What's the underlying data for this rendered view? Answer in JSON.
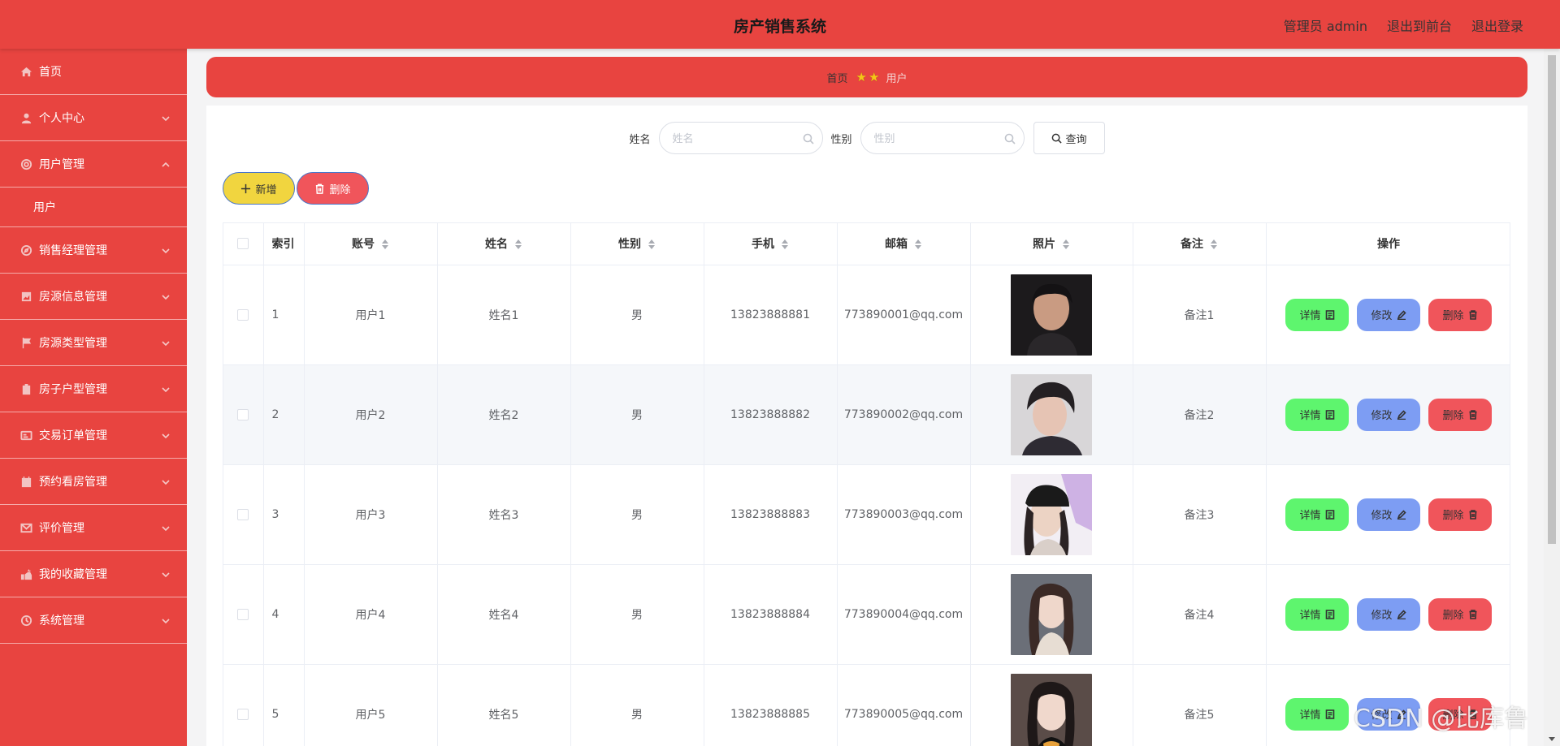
{
  "header": {
    "title": "房产销售系统",
    "admin_label": "管理员 admin",
    "front_link": "退出到前台",
    "logout_link": "退出登录"
  },
  "sidebar": {
    "items": [
      {
        "label": "首页",
        "icon": "home-icon",
        "has_chevron": false
      },
      {
        "label": "个人中心",
        "icon": "user-icon",
        "has_chevron": true
      },
      {
        "label": "用户管理",
        "icon": "users-gear-icon",
        "has_chevron": true,
        "expanded": true,
        "children": [
          {
            "label": "用户"
          }
        ]
      },
      {
        "label": "销售经理管理",
        "icon": "compass-icon",
        "has_chevron": true
      },
      {
        "label": "房源信息管理",
        "icon": "chart-icon",
        "has_chevron": true
      },
      {
        "label": "房源类型管理",
        "icon": "flag-icon",
        "has_chevron": true
      },
      {
        "label": "房子户型管理",
        "icon": "clipboard-icon",
        "has_chevron": true
      },
      {
        "label": "交易订单管理",
        "icon": "card-icon",
        "has_chevron": true
      },
      {
        "label": "预约看房管理",
        "icon": "calendar-icon",
        "has_chevron": true
      },
      {
        "label": "评价管理",
        "icon": "mail-icon",
        "has_chevron": true
      },
      {
        "label": "我的收藏管理",
        "icon": "star-hand-icon",
        "has_chevron": true
      },
      {
        "label": "系统管理",
        "icon": "settings-icon",
        "has_chevron": true
      }
    ]
  },
  "breadcrumb": {
    "home": "首页",
    "separator": "★★",
    "current": "用户"
  },
  "search": {
    "name_label": "姓名",
    "name_placeholder": "姓名",
    "name_value": "",
    "gender_label": "性别",
    "gender_placeholder": "性别",
    "gender_value": "",
    "query_button": "查询"
  },
  "actions": {
    "add_label": "新增",
    "delete_label": "删除"
  },
  "table": {
    "columns": [
      "索引",
      "账号",
      "姓名",
      "性别",
      "手机",
      "邮箱",
      "照片",
      "备注",
      "操作"
    ],
    "rows": [
      {
        "index": "1",
        "account": "用户1",
        "name": "姓名1",
        "gender": "男",
        "phone": "13823888881",
        "email": "773890001@qq.com",
        "remark": "备注1"
      },
      {
        "index": "2",
        "account": "用户2",
        "name": "姓名2",
        "gender": "男",
        "phone": "13823888882",
        "email": "773890002@qq.com",
        "remark": "备注2"
      },
      {
        "index": "3",
        "account": "用户3",
        "name": "姓名3",
        "gender": "男",
        "phone": "13823888883",
        "email": "773890003@qq.com",
        "remark": "备注3"
      },
      {
        "index": "4",
        "account": "用户4",
        "name": "姓名4",
        "gender": "男",
        "phone": "13823888884",
        "email": "773890004@qq.com",
        "remark": "备注4"
      },
      {
        "index": "5",
        "account": "用户5",
        "name": "姓名5",
        "gender": "男",
        "phone": "13823888885",
        "email": "773890005@qq.com",
        "remark": "备注5"
      }
    ],
    "op_detail": "详情",
    "op_edit": "修改",
    "op_delete": "删除"
  },
  "watermark": "CSDN @比库鲁",
  "colors": {
    "primary": "#e84440",
    "add_button": "#f1d53f",
    "delete_button": "#f0555b",
    "detail_button": "#5ef56e",
    "edit_button": "#7d9df3"
  }
}
